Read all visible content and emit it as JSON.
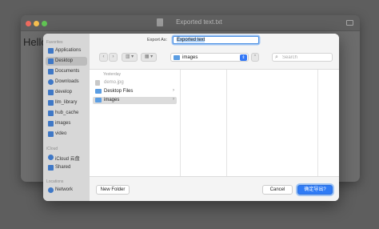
{
  "background_window": {
    "title": "Exported text.txt",
    "content_text": "Hello"
  },
  "dialog": {
    "save_as_label": "Export As:",
    "file_name": "Exported text",
    "location": "images",
    "search_placeholder": "Search",
    "toolbar": {
      "back_icon": "‹",
      "forward_icon": "›",
      "view_columns_icon": "▥ ▾",
      "view_grid_icon": "▦ ▾",
      "chevron_icon": "⇕",
      "expand_icon": "⌃",
      "search_icon": "⌕"
    },
    "sidebar": {
      "favorites_heading": "Favorites",
      "favorites": [
        {
          "label": "Applications",
          "icon": "applications-icon"
        },
        {
          "label": "Desktop",
          "icon": "desktop-icon",
          "selected": true
        },
        {
          "label": "Documents",
          "icon": "documents-icon"
        },
        {
          "label": "Downloads",
          "icon": "downloads-icon"
        },
        {
          "label": "develop",
          "icon": "folder-icon"
        },
        {
          "label": "llm_library",
          "icon": "folder-icon"
        },
        {
          "label": "hub_cache",
          "icon": "folder-icon"
        },
        {
          "label": "images",
          "icon": "folder-icon"
        },
        {
          "label": "video",
          "icon": "folder-icon"
        }
      ],
      "icloud_heading": "iCloud",
      "icloud": [
        {
          "label": "iCloud 云盘",
          "icon": "cloud-icon"
        },
        {
          "label": "Shared",
          "icon": "shared-folder-icon"
        }
      ],
      "locations_heading": "Locations",
      "locations": [
        {
          "label": "Network",
          "icon": "network-icon"
        }
      ]
    },
    "browser": {
      "column_heading": "Yesterday",
      "rows": [
        {
          "label": "demo.jpg",
          "type": "file",
          "dimmed": true
        },
        {
          "label": "Desktop Files",
          "type": "folder",
          "arrow": "›"
        },
        {
          "label": "images",
          "type": "folder",
          "selected": true,
          "arrow": "›"
        }
      ]
    },
    "new_folder_label": "New Folder",
    "cancel_label": "Cancel",
    "confirm_label": "确定导出?"
  },
  "colors": {
    "accent": "#2f7bf5",
    "folder": "#5b9de2",
    "sidebar_bg": "#d7d7d7",
    "dialog_bg": "#f4f4f4"
  }
}
